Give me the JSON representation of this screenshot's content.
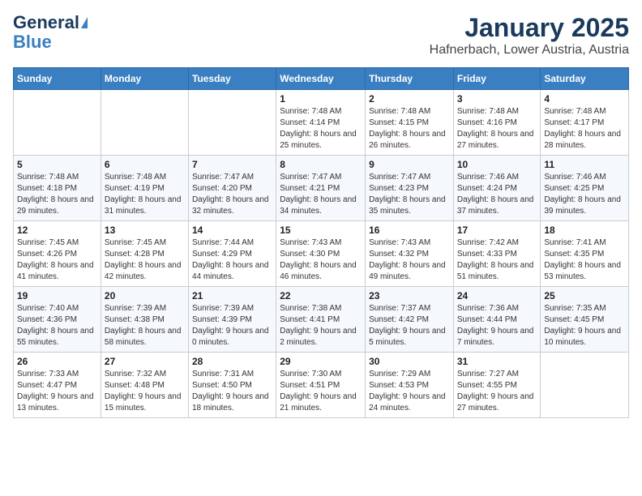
{
  "header": {
    "logo_line1": "General",
    "logo_line2": "Blue",
    "title": "January 2025",
    "subtitle": "Hafnerbach, Lower Austria, Austria"
  },
  "calendar": {
    "days_of_week": [
      "Sunday",
      "Monday",
      "Tuesday",
      "Wednesday",
      "Thursday",
      "Friday",
      "Saturday"
    ],
    "weeks": [
      [
        {
          "day": "",
          "info": ""
        },
        {
          "day": "",
          "info": ""
        },
        {
          "day": "",
          "info": ""
        },
        {
          "day": "1",
          "info": "Sunrise: 7:48 AM\nSunset: 4:14 PM\nDaylight: 8 hours\nand 25 minutes."
        },
        {
          "day": "2",
          "info": "Sunrise: 7:48 AM\nSunset: 4:15 PM\nDaylight: 8 hours\nand 26 minutes."
        },
        {
          "day": "3",
          "info": "Sunrise: 7:48 AM\nSunset: 4:16 PM\nDaylight: 8 hours\nand 27 minutes."
        },
        {
          "day": "4",
          "info": "Sunrise: 7:48 AM\nSunset: 4:17 PM\nDaylight: 8 hours\nand 28 minutes."
        }
      ],
      [
        {
          "day": "5",
          "info": "Sunrise: 7:48 AM\nSunset: 4:18 PM\nDaylight: 8 hours\nand 29 minutes."
        },
        {
          "day": "6",
          "info": "Sunrise: 7:48 AM\nSunset: 4:19 PM\nDaylight: 8 hours\nand 31 minutes."
        },
        {
          "day": "7",
          "info": "Sunrise: 7:47 AM\nSunset: 4:20 PM\nDaylight: 8 hours\nand 32 minutes."
        },
        {
          "day": "8",
          "info": "Sunrise: 7:47 AM\nSunset: 4:21 PM\nDaylight: 8 hours\nand 34 minutes."
        },
        {
          "day": "9",
          "info": "Sunrise: 7:47 AM\nSunset: 4:23 PM\nDaylight: 8 hours\nand 35 minutes."
        },
        {
          "day": "10",
          "info": "Sunrise: 7:46 AM\nSunset: 4:24 PM\nDaylight: 8 hours\nand 37 minutes."
        },
        {
          "day": "11",
          "info": "Sunrise: 7:46 AM\nSunset: 4:25 PM\nDaylight: 8 hours\nand 39 minutes."
        }
      ],
      [
        {
          "day": "12",
          "info": "Sunrise: 7:45 AM\nSunset: 4:26 PM\nDaylight: 8 hours\nand 41 minutes."
        },
        {
          "day": "13",
          "info": "Sunrise: 7:45 AM\nSunset: 4:28 PM\nDaylight: 8 hours\nand 42 minutes."
        },
        {
          "day": "14",
          "info": "Sunrise: 7:44 AM\nSunset: 4:29 PM\nDaylight: 8 hours\nand 44 minutes."
        },
        {
          "day": "15",
          "info": "Sunrise: 7:43 AM\nSunset: 4:30 PM\nDaylight: 8 hours\nand 46 minutes."
        },
        {
          "day": "16",
          "info": "Sunrise: 7:43 AM\nSunset: 4:32 PM\nDaylight: 8 hours\nand 49 minutes."
        },
        {
          "day": "17",
          "info": "Sunrise: 7:42 AM\nSunset: 4:33 PM\nDaylight: 8 hours\nand 51 minutes."
        },
        {
          "day": "18",
          "info": "Sunrise: 7:41 AM\nSunset: 4:35 PM\nDaylight: 8 hours\nand 53 minutes."
        }
      ],
      [
        {
          "day": "19",
          "info": "Sunrise: 7:40 AM\nSunset: 4:36 PM\nDaylight: 8 hours\nand 55 minutes."
        },
        {
          "day": "20",
          "info": "Sunrise: 7:39 AM\nSunset: 4:38 PM\nDaylight: 8 hours\nand 58 minutes."
        },
        {
          "day": "21",
          "info": "Sunrise: 7:39 AM\nSunset: 4:39 PM\nDaylight: 9 hours\nand 0 minutes."
        },
        {
          "day": "22",
          "info": "Sunrise: 7:38 AM\nSunset: 4:41 PM\nDaylight: 9 hours\nand 2 minutes."
        },
        {
          "day": "23",
          "info": "Sunrise: 7:37 AM\nSunset: 4:42 PM\nDaylight: 9 hours\nand 5 minutes."
        },
        {
          "day": "24",
          "info": "Sunrise: 7:36 AM\nSunset: 4:44 PM\nDaylight: 9 hours\nand 7 minutes."
        },
        {
          "day": "25",
          "info": "Sunrise: 7:35 AM\nSunset: 4:45 PM\nDaylight: 9 hours\nand 10 minutes."
        }
      ],
      [
        {
          "day": "26",
          "info": "Sunrise: 7:33 AM\nSunset: 4:47 PM\nDaylight: 9 hours\nand 13 minutes."
        },
        {
          "day": "27",
          "info": "Sunrise: 7:32 AM\nSunset: 4:48 PM\nDaylight: 9 hours\nand 15 minutes."
        },
        {
          "day": "28",
          "info": "Sunrise: 7:31 AM\nSunset: 4:50 PM\nDaylight: 9 hours\nand 18 minutes."
        },
        {
          "day": "29",
          "info": "Sunrise: 7:30 AM\nSunset: 4:51 PM\nDaylight: 9 hours\nand 21 minutes."
        },
        {
          "day": "30",
          "info": "Sunrise: 7:29 AM\nSunset: 4:53 PM\nDaylight: 9 hours\nand 24 minutes."
        },
        {
          "day": "31",
          "info": "Sunrise: 7:27 AM\nSunset: 4:55 PM\nDaylight: 9 hours\nand 27 minutes."
        },
        {
          "day": "",
          "info": ""
        }
      ]
    ]
  }
}
